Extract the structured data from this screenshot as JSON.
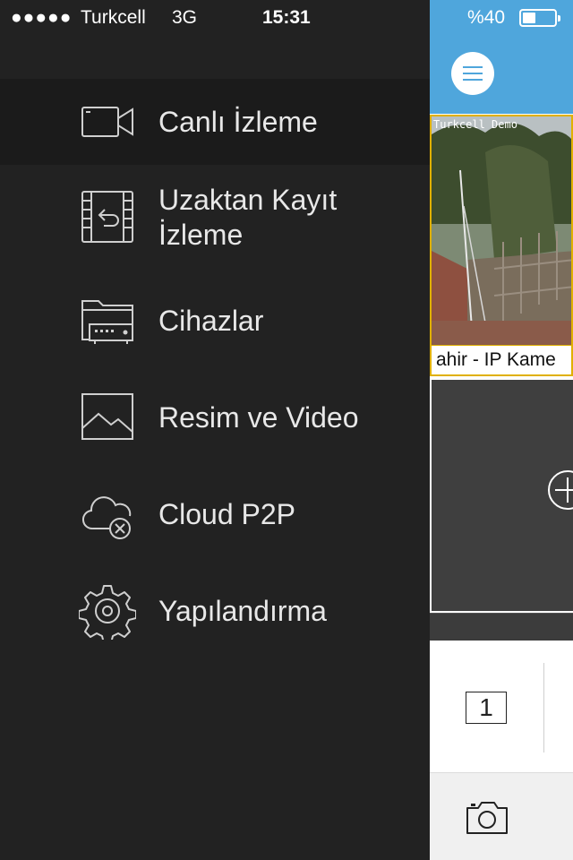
{
  "status_bar": {
    "signal": "●●●●●",
    "carrier": "Turkcell",
    "network": "3G",
    "time": "15:31",
    "battery_percent": "%40",
    "battery_level": 0.4
  },
  "menu": {
    "items": [
      {
        "label": "Canlı İzleme",
        "icon": "video-camera-icon",
        "active": true
      },
      {
        "label": "Uzaktan Kayıt İzleme",
        "line1": "Uzaktan Kayıt",
        "line2": "İzleme",
        "icon": "playback-icon"
      },
      {
        "label": "Cihazlar",
        "icon": "devices-icon"
      },
      {
        "label": "Resim ve Video",
        "icon": "gallery-icon"
      },
      {
        "label": "Cloud P2P",
        "icon": "cloud-offline-icon"
      },
      {
        "label": "Yapılandırma",
        "icon": "gear-icon"
      }
    ]
  },
  "live_panel": {
    "accent": "#4fa6dc",
    "camera": {
      "overlay_text": "Turkcell Demo",
      "label": "ahir - IP Kame",
      "border_color": "#e0b000"
    },
    "layout_label": "1",
    "snapshot_icon": "camera-icon"
  }
}
